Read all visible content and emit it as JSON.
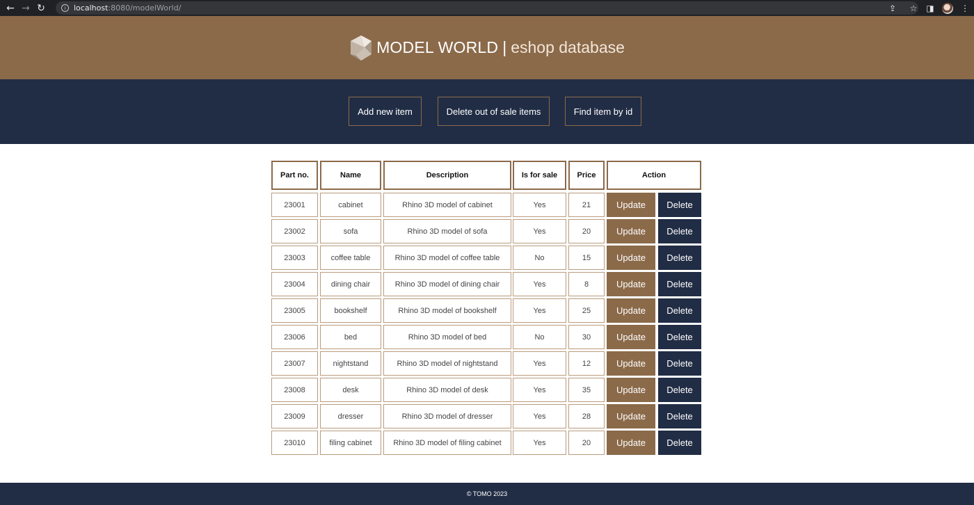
{
  "browser": {
    "back": "←",
    "forward": "→",
    "reload": "↻",
    "info": "i",
    "url_host": "localhost",
    "url_path": ":8080/modelWorld/",
    "share": "⇪",
    "star": "☆",
    "sidebar": "◨",
    "menu": "⋮"
  },
  "header": {
    "brand": "MODEL WORLD",
    "separator": "|",
    "subtitle": "eshop database"
  },
  "nav": {
    "add_label": "Add new item",
    "delete_label": "Delete out of sale items",
    "find_label": "Find item by id"
  },
  "table": {
    "headers": [
      "Part no.",
      "Name",
      "Description",
      "Is for sale",
      "Price",
      "Action"
    ],
    "update_label": "Update",
    "delete_label": "Delete",
    "rows": [
      {
        "part_no": "23001",
        "name": "cabinet",
        "description": "Rhino 3D model of cabinet",
        "for_sale": "Yes",
        "price": "21"
      },
      {
        "part_no": "23002",
        "name": "sofa",
        "description": "Rhino 3D model of sofa",
        "for_sale": "Yes",
        "price": "20"
      },
      {
        "part_no": "23003",
        "name": "coffee table",
        "description": "Rhino 3D model of coffee table",
        "for_sale": "No",
        "price": "15"
      },
      {
        "part_no": "23004",
        "name": "dining chair",
        "description": "Rhino 3D model of dining chair",
        "for_sale": "Yes",
        "price": "8"
      },
      {
        "part_no": "23005",
        "name": "bookshelf",
        "description": "Rhino 3D model of bookshelf",
        "for_sale": "Yes",
        "price": "25"
      },
      {
        "part_no": "23006",
        "name": "bed",
        "description": "Rhino 3D model of bed",
        "for_sale": "No",
        "price": "30"
      },
      {
        "part_no": "23007",
        "name": "nightstand",
        "description": "Rhino 3D model of nightstand",
        "for_sale": "Yes",
        "price": "12"
      },
      {
        "part_no": "23008",
        "name": "desk",
        "description": "Rhino 3D model of desk",
        "for_sale": "Yes",
        "price": "35"
      },
      {
        "part_no": "23009",
        "name": "dresser",
        "description": "Rhino 3D model of dresser",
        "for_sale": "Yes",
        "price": "28"
      },
      {
        "part_no": "23010",
        "name": "filing cabinet",
        "description": "Rhino 3D model of filing cabinet",
        "for_sale": "Yes",
        "price": "20"
      }
    ]
  },
  "footer": {
    "copyright": "© TOMO 2023"
  },
  "colors": {
    "brand_brown": "#8b6a4a",
    "navy": "#212d45",
    "white": "#ffffff"
  }
}
